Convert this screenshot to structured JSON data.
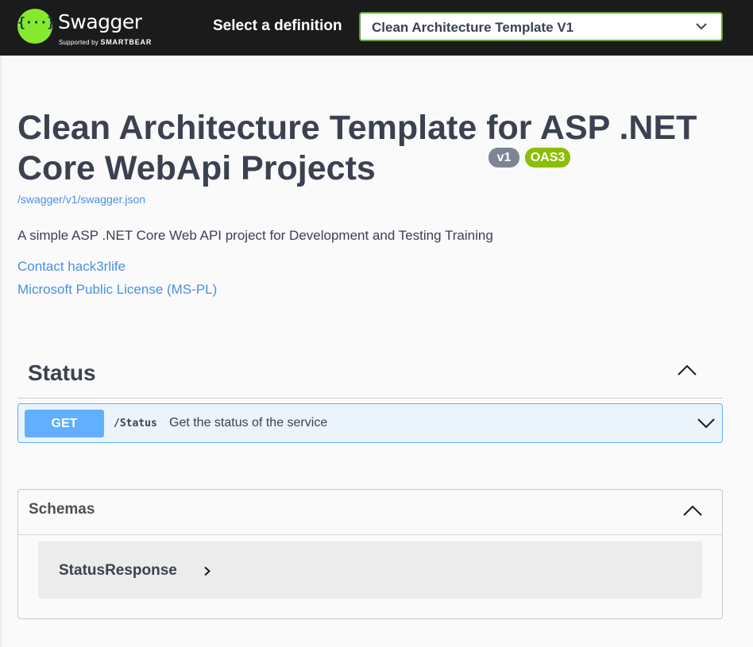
{
  "topbar": {
    "logo_text": "Swagger",
    "logo_glyph": "{···}",
    "logo_sub_prefix": "Supported by",
    "logo_sub_brand": "SMARTBEAR",
    "definition_label": "Select a definition",
    "definition_value": "Clean Architecture Template V1",
    "brand_color": "#85ea2d",
    "bar_color": "#1b1b1b"
  },
  "info": {
    "title": "Clean Architecture Template for ASP .NET Core WebApi Projects",
    "version_badge": "v1",
    "oas_badge": "OAS3",
    "spec_url": "/swagger/v1/swagger.json",
    "description": "A simple ASP .NET Core Web API project for Development and Testing Training",
    "contact": "Contact hack3rlife",
    "license": "Microsoft Public License (MS-PL)"
  },
  "tags": [
    {
      "name": "Status",
      "expanded": true,
      "operations": [
        {
          "method": "GET",
          "path": "/Status",
          "summary": "Get the status of the service",
          "color": "#61affe"
        }
      ]
    }
  ],
  "schemas": {
    "title": "Schemas",
    "expanded": true,
    "items": [
      {
        "name": "StatusResponse"
      }
    ]
  },
  "icons": {
    "definition_dropdown": "chevron-down-icon",
    "tag_toggle": "chevron-up-icon",
    "operation_toggle": "chevron-down-icon",
    "schemas_toggle": "chevron-up-icon",
    "model_expand": "chevron-right-icon"
  }
}
